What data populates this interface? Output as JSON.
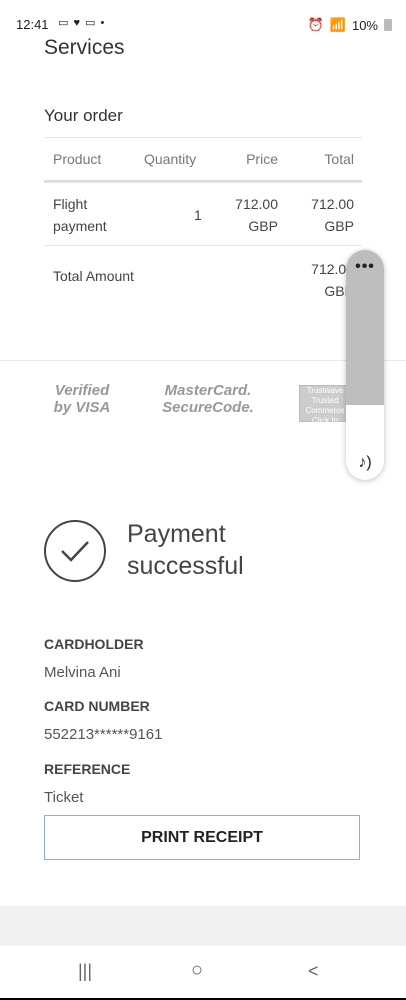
{
  "status_bar": {
    "time": "12:41",
    "left_icons": "▭ ♥ ▭ •",
    "right_text": "10%"
  },
  "page": {
    "services_title": "Services",
    "order_title": "Your order"
  },
  "order_table": {
    "headers": [
      "Product",
      "Quantity",
      "Price",
      "Total"
    ],
    "rows": [
      {
        "product": "Flight payment",
        "quantity": "1",
        "price": "712.00 GBP",
        "total": "712.00 GBP"
      }
    ],
    "total_label": "Total Amount",
    "total_value": "712.00 GBP"
  },
  "logos": {
    "visa": "Verified by VISA",
    "mastercard": "MasterCard. SecureCode.",
    "trustwave": "Trustwave Trusted Commerce Click to Validate"
  },
  "overlay": {
    "dots": "•••",
    "music_icon": "♪)"
  },
  "payment": {
    "status_text": "Payment successful",
    "cardholder_label": "CARDHOLDER",
    "cardholder_value": "Melvina Ani",
    "card_number_label": "CARD NUMBER",
    "card_number_value": "552213******9161",
    "reference_label": "REFERENCE",
    "reference_value": "Ticket",
    "print_button": "PRINT RECEIPT"
  },
  "navbar": {
    "recents": "|||",
    "home": "○",
    "back": "<"
  }
}
